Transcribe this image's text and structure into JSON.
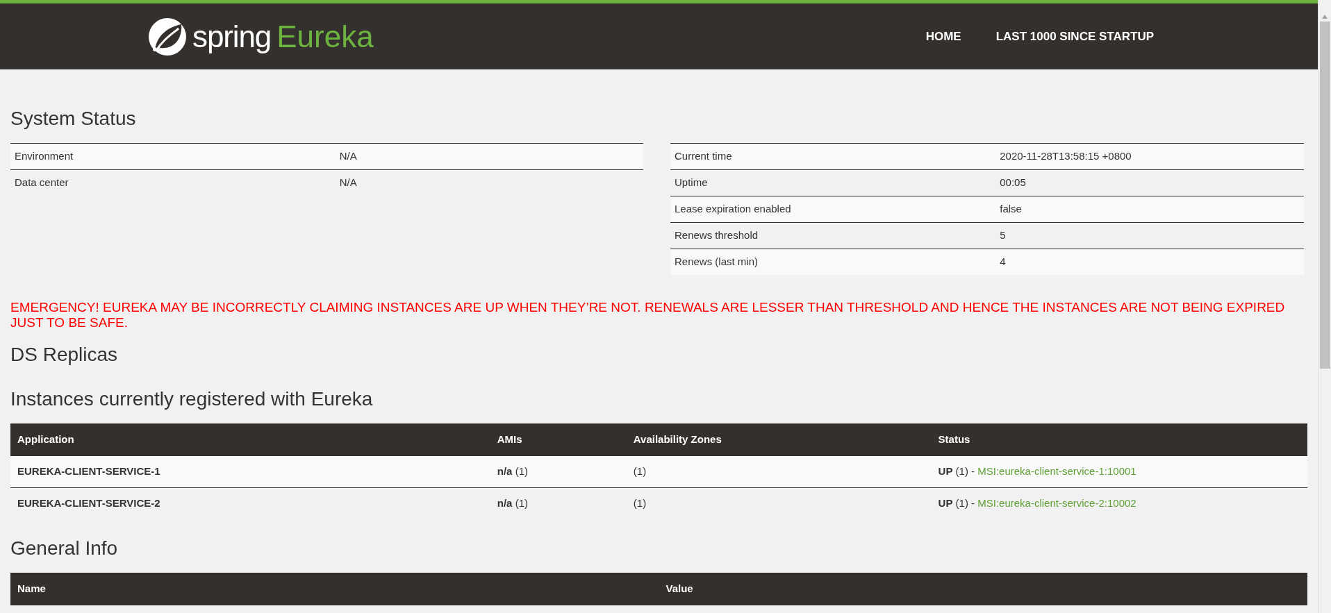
{
  "header": {
    "logo": {
      "word": "spring",
      "product": "Eureka"
    },
    "nav": [
      "HOME",
      "LAST 1000 SINCE STARTUP"
    ]
  },
  "system_status": {
    "title": "System Status",
    "left_rows": [
      {
        "label": "Environment",
        "value": "N/A"
      },
      {
        "label": "Data center",
        "value": "N/A"
      }
    ],
    "right_rows": [
      {
        "label": "Current time",
        "value": "2020-11-28T13:58:15 +0800"
      },
      {
        "label": "Uptime",
        "value": "00:05"
      },
      {
        "label": "Lease expiration enabled",
        "value": "false"
      },
      {
        "label": "Renews threshold",
        "value": "5"
      },
      {
        "label": "Renews (last min)",
        "value": "4"
      }
    ]
  },
  "emergency": "EMERGENCY! EUREKA MAY BE INCORRECTLY CLAIMING INSTANCES ARE UP WHEN THEY’RE NOT. RENEWALS ARE LESSER THAN THRESHOLD AND HENCE THE INSTANCES ARE NOT BEING EXPIRED JUST TO BE SAFE.",
  "ds_replicas": {
    "title": "DS Replicas"
  },
  "instances": {
    "title": "Instances currently registered with Eureka",
    "columns": [
      "Application",
      "AMIs",
      "Availability Zones",
      "Status"
    ],
    "rows": [
      {
        "application": "EUREKA-CLIENT-SERVICE-1",
        "amis": "**n/a** (1)",
        "zones": "(1)",
        "status": "**UP** (1) - ",
        "link": "MSI:eureka-client-service-1:10001"
      },
      {
        "application": "EUREKA-CLIENT-SERVICE-2",
        "amis": "**n/a** (1)",
        "zones": "(1)",
        "status": "**UP** (1) - ",
        "link": "MSI:eureka-client-service-2:10002"
      }
    ]
  },
  "general_info": {
    "title": "General Info",
    "columns": [
      "Name",
      "Value"
    ]
  }
}
